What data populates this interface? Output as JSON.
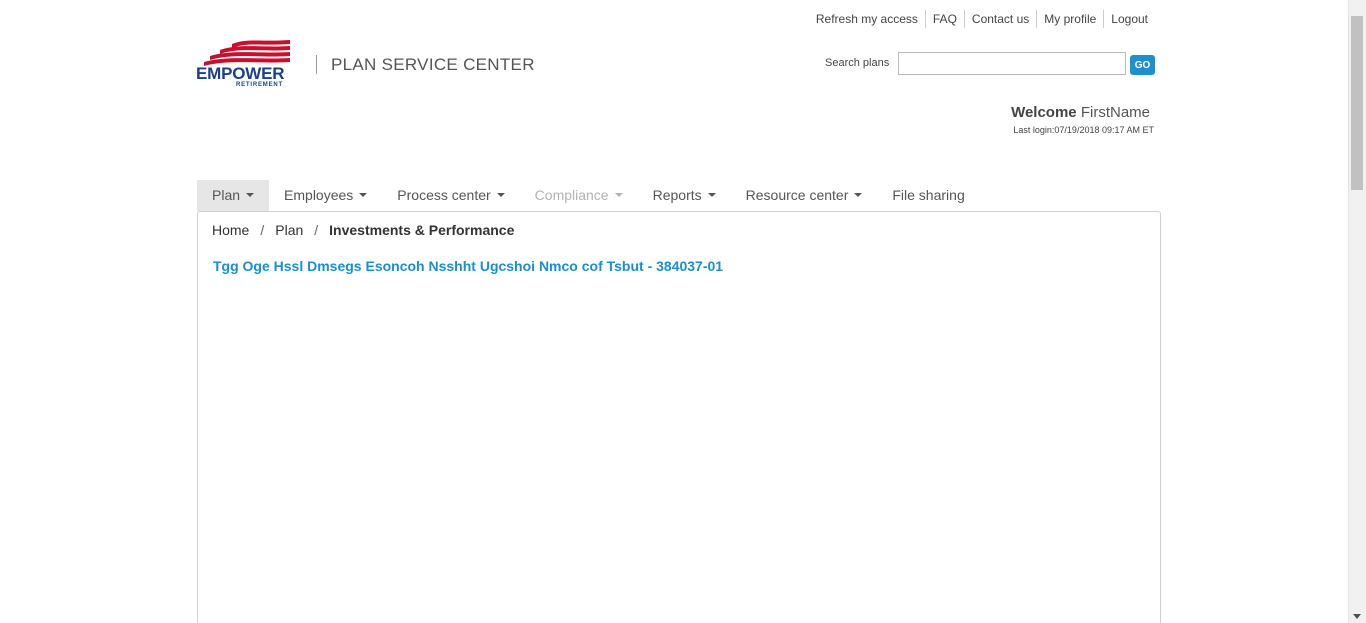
{
  "utility_links": [
    "Refresh my access",
    "FAQ",
    "Contact us",
    "My profile",
    "Logout"
  ],
  "logo": {
    "wordmark": "EMPOWER",
    "sub": "RETIREMENT",
    "flag_color": "#c8102e"
  },
  "header": {
    "app_title": "PLAN SERVICE CENTER"
  },
  "search": {
    "label": "Search plans",
    "value": "",
    "button": "GO"
  },
  "welcome": {
    "greeting": "Welcome",
    "name": "FirstName",
    "last_login": "Last login:07/19/2018 09:17 AM ET"
  },
  "nav": {
    "items": [
      {
        "label": "Plan",
        "dropdown": true,
        "active": true,
        "disabled": false
      },
      {
        "label": "Employees",
        "dropdown": true,
        "active": false,
        "disabled": false
      },
      {
        "label": "Process center",
        "dropdown": true,
        "active": false,
        "disabled": false
      },
      {
        "label": "Compliance",
        "dropdown": true,
        "active": false,
        "disabled": true
      },
      {
        "label": "Reports",
        "dropdown": true,
        "active": false,
        "disabled": false
      },
      {
        "label": "Resource center",
        "dropdown": true,
        "active": false,
        "disabled": false
      },
      {
        "label": "File sharing",
        "dropdown": false,
        "active": false,
        "disabled": false
      }
    ]
  },
  "breadcrumb": {
    "items": [
      "Home",
      "Plan",
      "Investments & Performance"
    ],
    "separator": "/"
  },
  "main": {
    "plan_title": "Tgg Oge Hssl Dmsegs Esoncoh Nsshht Ugcshoi Nmco cof Tsbut - 384037-01"
  },
  "colors": {
    "accent": "#1a8fd0",
    "brand": "#1a3f8f",
    "go_button": "#1e90d0"
  }
}
